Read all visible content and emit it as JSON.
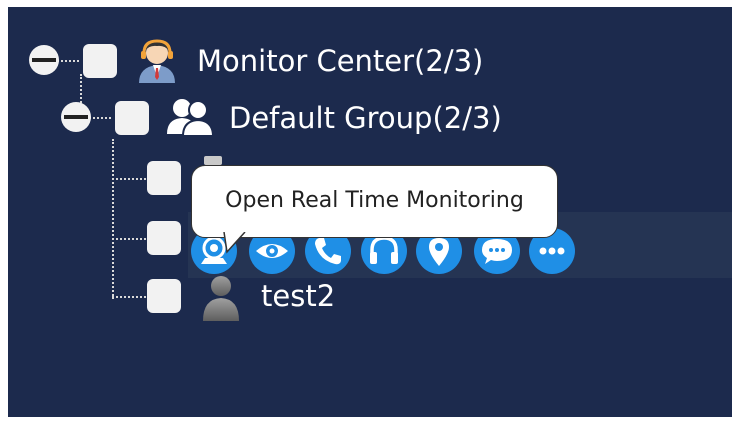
{
  "tree": {
    "root": {
      "label": "Monitor Center(2/3)",
      "icon": "monitor-center-user-icon"
    },
    "group": {
      "label": "Default Group(2/3)",
      "icon": "group-users-icon"
    },
    "devices": [
      {
        "label": "",
        "icon": "device-icon"
      },
      {
        "label": "",
        "icon": "device-icon"
      },
      {
        "label": "test2",
        "icon": "user-offline-icon"
      }
    ]
  },
  "actions": [
    {
      "name": "real-time-monitoring-button",
      "icon": "webcam-icon"
    },
    {
      "name": "view-button",
      "icon": "eye-icon"
    },
    {
      "name": "call-button",
      "icon": "phone-icon"
    },
    {
      "name": "listen-button",
      "icon": "headset-icon"
    },
    {
      "name": "location-button",
      "icon": "map-pin-icon"
    },
    {
      "name": "message-button",
      "icon": "chat-bubble-icon"
    },
    {
      "name": "more-button",
      "icon": "more-dots-icon"
    }
  ],
  "tooltip": {
    "text": "Open Real Time Monitoring"
  },
  "colors": {
    "panel_background": "#1c2a4d",
    "row_highlight": "#253453",
    "action_blue": "#1f8fe6",
    "text": "#ffffff"
  }
}
